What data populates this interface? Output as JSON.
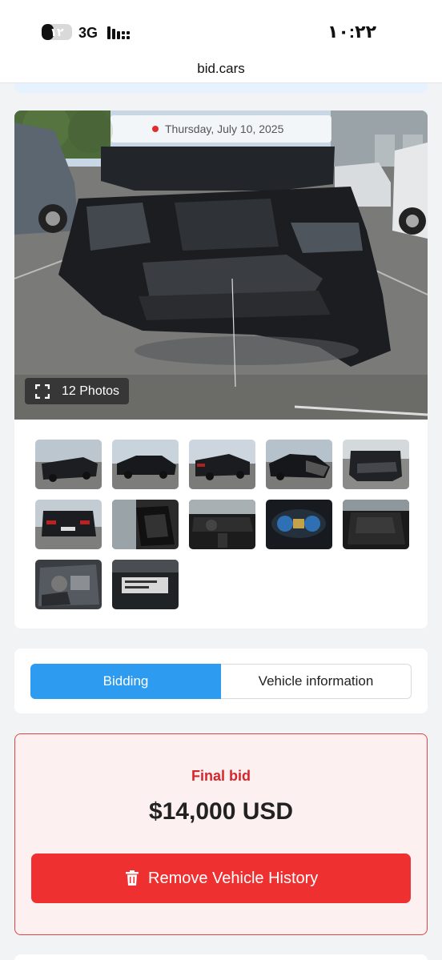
{
  "status_bar": {
    "battery_level": "١٢",
    "battery_fraction": 0.4,
    "network": "3G",
    "time": "١٠:٢٢"
  },
  "browser": {
    "url": "bid.cars"
  },
  "gallery": {
    "date": "Thursday, July 10, 2025",
    "photos_count_label": "12 Photos",
    "thumbnails": [
      {
        "subject": "front-left-damaged"
      },
      {
        "subject": "left-side"
      },
      {
        "subject": "rear-left"
      },
      {
        "subject": "front-right-damaged"
      },
      {
        "subject": "front-close-up"
      },
      {
        "subject": "rear"
      },
      {
        "subject": "interior-front-seat"
      },
      {
        "subject": "dashboard"
      },
      {
        "subject": "instrument-cluster"
      },
      {
        "subject": "interior-rear-seat"
      },
      {
        "subject": "engine-bay"
      },
      {
        "subject": "vin-label"
      }
    ]
  },
  "tabs": {
    "bidding": "Bidding",
    "vehicle_information": "Vehicle information",
    "active": "bidding"
  },
  "final_bid": {
    "label": "Final bid",
    "amount": "$14,000 USD",
    "remove_button": "Remove Vehicle History"
  },
  "colors": {
    "accent_blue": "#2d9bf0",
    "alert_red": "#ef3030",
    "final_bid_label": "#d9242a",
    "status_dot": "#e32d2d"
  }
}
